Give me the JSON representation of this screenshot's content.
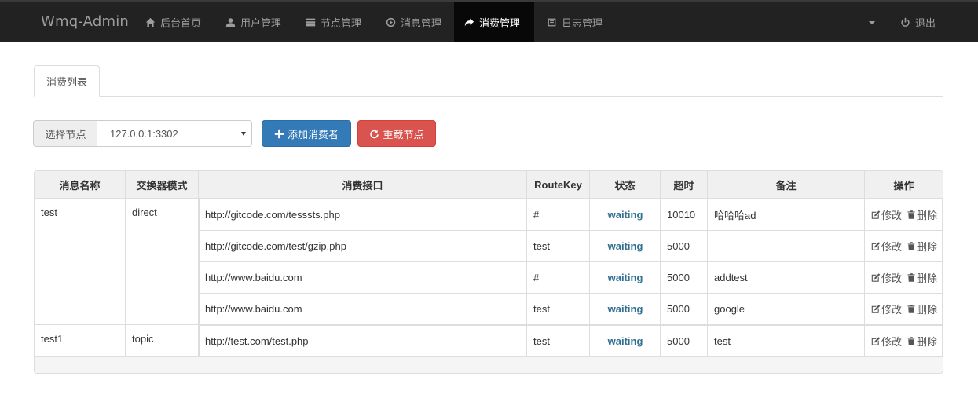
{
  "navbar": {
    "brand": "Wmq-Admin",
    "items": [
      {
        "label": "后台首页",
        "icon": "home-icon"
      },
      {
        "label": "用户管理",
        "icon": "user-icon"
      },
      {
        "label": "节点管理",
        "icon": "server-icon"
      },
      {
        "label": "消息管理",
        "icon": "play-circle-icon"
      },
      {
        "label": "消费管理",
        "icon": "share-arrow-icon",
        "active": true
      },
      {
        "label": "日志管理",
        "icon": "list-alt-icon"
      }
    ],
    "logout": "退出"
  },
  "tabs": [
    "消费列表"
  ],
  "toolbar": {
    "node_label": "选择节点",
    "node_value": "127.0.0.1:3302",
    "add_button": "添加消费者",
    "reload_button": "重载节点"
  },
  "table": {
    "headers": [
      "消息名称",
      "交换器模式",
      "消费接口",
      "RouteKey",
      "状态",
      "超时",
      "备注",
      "操作"
    ],
    "groups": [
      {
        "name": "test",
        "mode": "direct",
        "rows": [
          {
            "url": "http://gitcode.com/tesssts.php",
            "routekey": "#",
            "status": "waiting",
            "timeout": "10010",
            "note": "哈哈哈ad"
          },
          {
            "url": "http://gitcode.com/test/gzip.php",
            "routekey": "test",
            "status": "waiting",
            "timeout": "5000",
            "note": ""
          },
          {
            "url": "http://www.baidu.com",
            "routekey": "#",
            "status": "waiting",
            "timeout": "5000",
            "note": "addtest"
          },
          {
            "url": "http://www.baidu.com",
            "routekey": "test",
            "status": "waiting",
            "timeout": "5000",
            "note": "google"
          }
        ]
      },
      {
        "name": "test1",
        "mode": "topic",
        "rows": [
          {
            "url": "http://test.com/test.php",
            "routekey": "test",
            "status": "waiting",
            "timeout": "5000",
            "note": "test"
          }
        ]
      }
    ],
    "edit_label": "修改",
    "delete_label": "删除"
  },
  "colors": {
    "navbar_bg": "#222222",
    "primary": "#337ab7",
    "danger": "#d9534f",
    "status_text": "#31708f"
  }
}
